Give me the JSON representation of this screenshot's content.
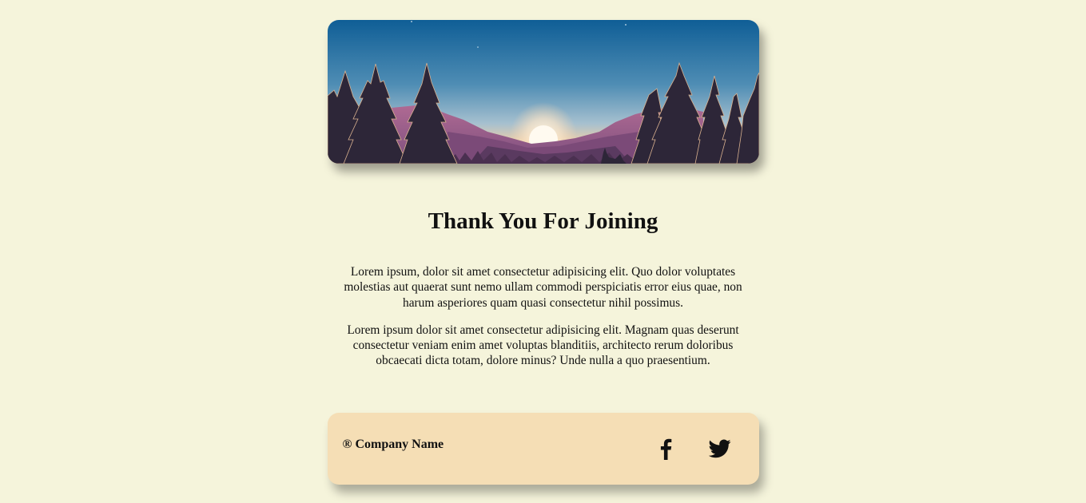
{
  "header": {
    "image_alt": "Mountain sunset landscape with pine trees"
  },
  "main": {
    "title": "Thank You For Joining",
    "paragraphs": [
      "Lorem ipsum, dolor sit amet consectetur adipisicing elit. Quo dolor voluptates molestias aut quaerat sunt nemo ullam commodi perspiciatis error eius quae, non harum asperiores quam quasi consectetur nihil possimus.",
      "Lorem ipsum dolor sit amet consectetur adipisicing elit. Magnam quas deserunt consectetur veniam enim amet voluptas blanditiis, architecto rerum doloribus obcaecati dicta totam, dolore minus? Unde nulla a quo praesentium."
    ]
  },
  "footer": {
    "company": "® Company Name",
    "icons": [
      "facebook-icon",
      "twitter-icon"
    ]
  },
  "colors": {
    "background": "#f5f4db",
    "footer": "#f5deb5",
    "trees": "#2d2638",
    "sky_top": "#0f5e96"
  }
}
